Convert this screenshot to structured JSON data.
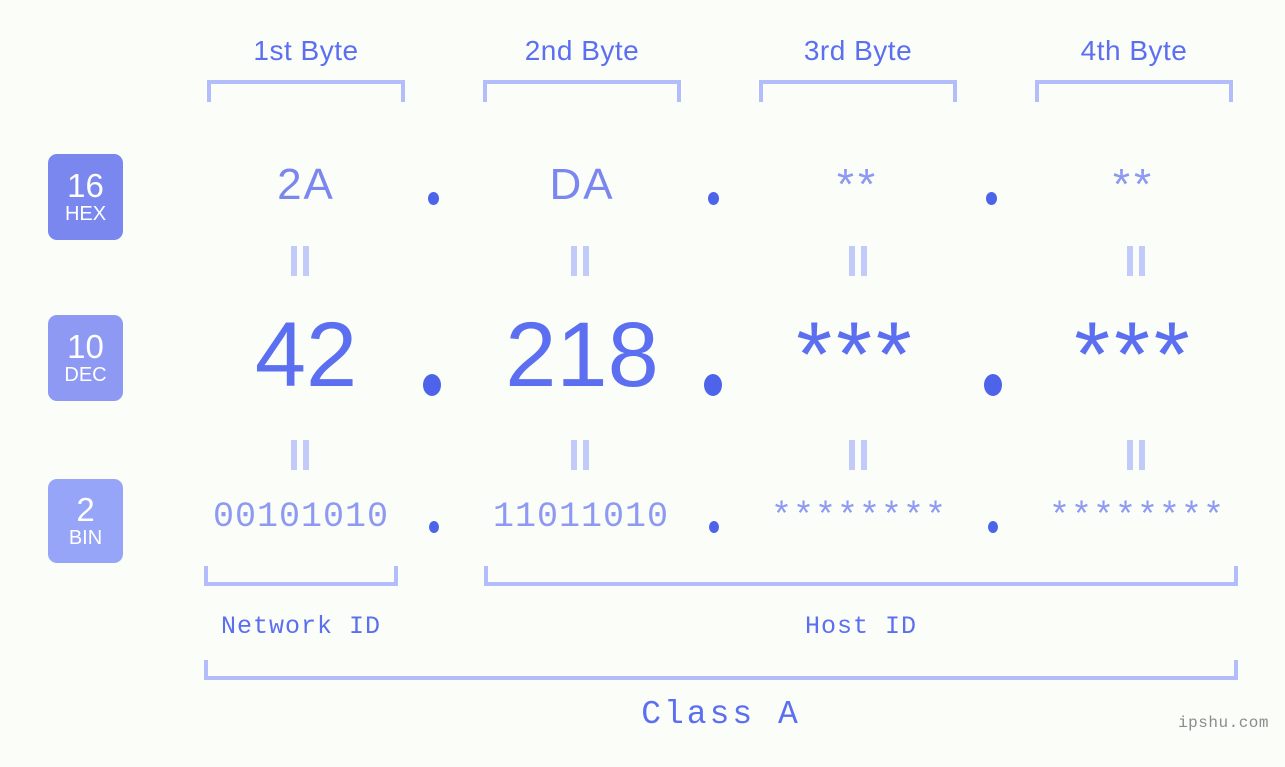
{
  "background_color": "#fbfdf8",
  "accent_color": "#5b6ff0",
  "bracket_color": "#b3bdfb",
  "header": {
    "byte_labels": [
      {
        "label": "1st Byte"
      },
      {
        "label": "2nd Byte"
      },
      {
        "label": "3rd Byte"
      },
      {
        "label": "4th Byte"
      }
    ]
  },
  "bases": [
    {
      "id": "hex",
      "number": "16",
      "abbr": "HEX",
      "color": "#7a87ee"
    },
    {
      "id": "dec",
      "number": "10",
      "abbr": "DEC",
      "color": "#8d99f2"
    },
    {
      "id": "bin",
      "number": "2",
      "abbr": "BIN",
      "color": "#96a5f7"
    }
  ],
  "rows": {
    "hex": {
      "separator": ".",
      "octets": [
        "2A",
        "DA",
        "**",
        "**"
      ]
    },
    "dec": {
      "separator": ".",
      "octets": [
        "42",
        "218",
        "***",
        "***"
      ]
    },
    "bin": {
      "separator": ".",
      "octets": [
        "00101010",
        "11011010",
        "********",
        "********"
      ]
    }
  },
  "equals_symbol": "||",
  "segments": {
    "network_id": "Network ID",
    "host_id": "Host ID"
  },
  "class": {
    "label": "Class A"
  },
  "watermark": "ipshu.com"
}
